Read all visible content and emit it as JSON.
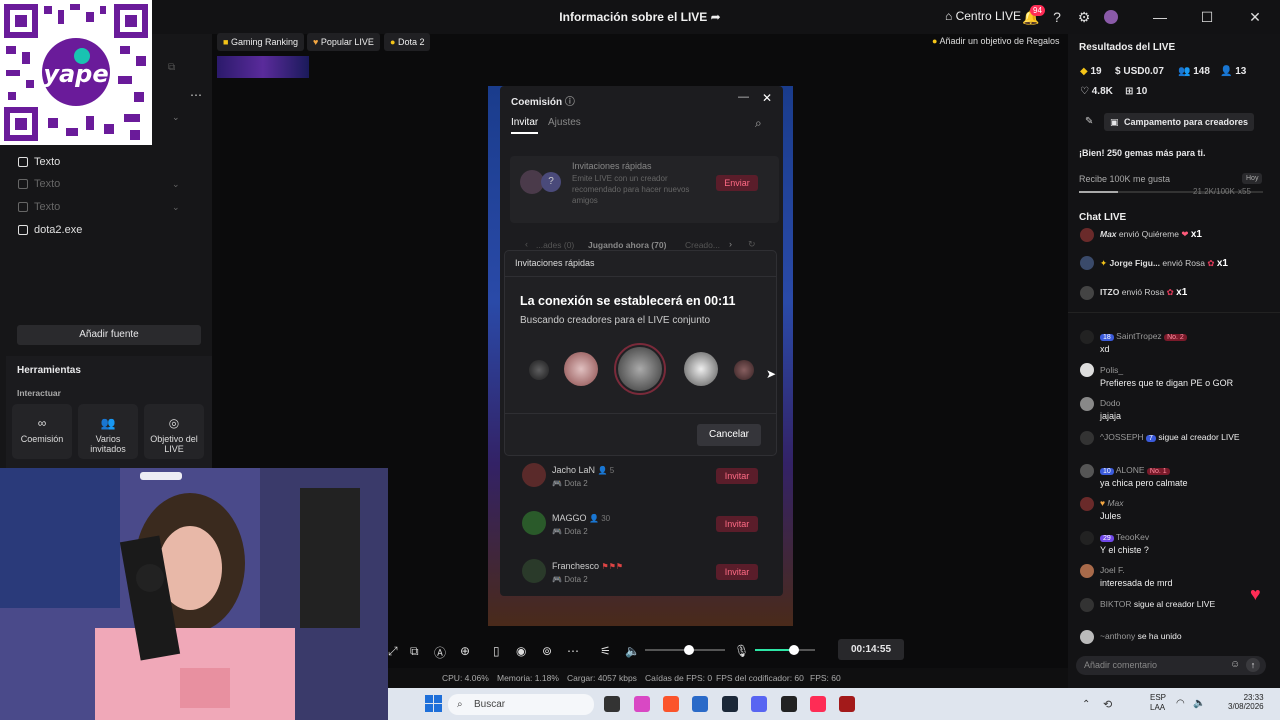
{
  "window": {
    "title": "Información sobre el LIVE",
    "centro_label": "Centro LIVE",
    "notif_count": "94"
  },
  "left": {
    "sources": [
      "Texto",
      "Texto",
      "Texto",
      "dota2.exe"
    ],
    "add_source": "Añadir fuente",
    "tools_title": "Herramientas",
    "interact_label": "Interactuar",
    "tools": [
      "Coemisión",
      "Varios invitados",
      "Objetivo del LIVE"
    ],
    "qr_label": "yape"
  },
  "chips": [
    "Gaming Ranking",
    "Popular LIVE",
    "Dota 2"
  ],
  "goal_label": "Añadir un objetivo de Regalos",
  "coem": {
    "title": "Coemisión",
    "tabs": [
      "Invitar",
      "Ajustes"
    ],
    "quick_title": "Invitaciones rápidas",
    "quick_desc": "Emite LIVE con un creador recomendado para hacer nuevos amigos",
    "send": "Enviar",
    "filters": [
      "...ades (0)",
      "Jugando ahora (70)",
      "Creado..."
    ],
    "rows": [
      {
        "name": "Jacho LaN",
        "count": "5",
        "game": "Dota 2",
        "btn": "Invitar"
      },
      {
        "name": "MAGGO",
        "count": "30",
        "game": "Dota 2",
        "btn": "Invitar"
      },
      {
        "name": "Franchesco",
        "count": "",
        "game": "Dota 2",
        "btn": "Invitar"
      }
    ]
  },
  "popup": {
    "header": "Invitaciones rápidas",
    "title": "La conexión se establecerá en 00:11",
    "subtitle": "Buscando creadores para el LIVE conjunto",
    "cancel": "Cancelar"
  },
  "controls": {
    "timer": "00:14:55",
    "volume_level": 0.55,
    "mic_level": 0.65
  },
  "status": {
    "cpu": "CPU: 4.06%",
    "mem": "Memoria: 1.18%",
    "load": "Cargar: 4057 kbps",
    "drops": "Caídas de FPS: 0",
    "enc": "FPS del codificador: 60",
    "fps": "FPS: 60"
  },
  "taskbar": {
    "search": "Buscar",
    "lang": "ESP",
    "lang2": "LAA",
    "time": "23:33",
    "date": "3/08/2026"
  },
  "right": {
    "results_title": "Resultados del LIVE",
    "stats": [
      "19",
      "USD0.07",
      "148",
      "13",
      "4.8K",
      "10"
    ],
    "camp": "Campamento para creadores",
    "gems": "¡Bien! 250 gemas más para ti.",
    "likes_goal": "Recibe 100K me gusta",
    "likes_tag": "Hoy",
    "likes_progress": "21.2K/100K",
    "likes_mult": "x55",
    "chat_title": "Chat LIVE",
    "gifts": [
      {
        "user": "Max",
        "text": "envió Quiéreme",
        "mult": "x1"
      },
      {
        "user": "Jorge Figu...",
        "text": "envió Rosa",
        "mult": "x1"
      },
      {
        "user": "ITZO",
        "text": "envió Rosa",
        "mult": "x1"
      }
    ],
    "messages": [
      {
        "user": "SaintTropez",
        "level": "18",
        "no": "No. 2",
        "text": "xd"
      },
      {
        "user": "Polis_",
        "level": "",
        "no": "",
        "text": "Prefieres que te digan PE o GOR"
      },
      {
        "user": "Dodo",
        "level": "",
        "no": "",
        "text": "jajaja"
      },
      {
        "user": "^JOSSEPH",
        "level": "7",
        "no": "",
        "text": "sigue al creador LIVE"
      },
      {
        "user": "ALONE",
        "level": "10",
        "no": "No. 1",
        "text": "ya chica pero calmate"
      },
      {
        "user": "Max",
        "level": "",
        "no": "",
        "text": "Jules"
      },
      {
        "user": "TeooKev",
        "level": "29",
        "no": "",
        "text": "Y el chiste ?"
      },
      {
        "user": "Joel F.",
        "level": "",
        "no": "",
        "text": "interesada de mrd"
      },
      {
        "user": "BIKTOR",
        "level": "",
        "no": "",
        "text": "sigue al creador LIVE"
      },
      {
        "user": "~anthony",
        "level": "",
        "no": "",
        "text": "se ha unido"
      }
    ],
    "comment_placeholder": "Añadir comentario"
  }
}
